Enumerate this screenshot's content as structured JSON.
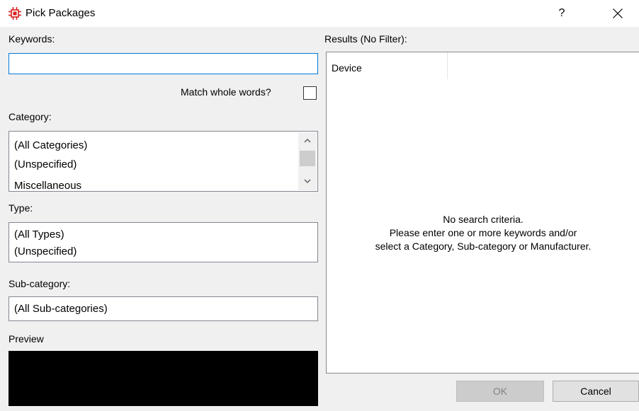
{
  "window": {
    "title": "Pick Packages",
    "help_label": "?",
    "app_icon": "chip-icon",
    "close_icon": "close-icon"
  },
  "keywords": {
    "label": "Keywords:",
    "value": "",
    "match_whole_words_label": "Match whole words?",
    "match_whole_words_checked": false
  },
  "category": {
    "label": "Category:",
    "items": [
      "(All Categories)",
      "(Unspecified)",
      "Miscellaneous"
    ]
  },
  "type": {
    "label": "Type:",
    "items": [
      "(All Types)",
      "(Unspecified)"
    ]
  },
  "subcategory": {
    "label": "Sub-category:",
    "items": [
      "(All Sub-categories)"
    ]
  },
  "preview": {
    "label": "Preview"
  },
  "results": {
    "label": "Results (No Filter):",
    "columns": [
      "Device"
    ],
    "empty_message": [
      "No search criteria.",
      "Please enter one or more keywords and/or",
      "select a Category, Sub-category or Manufacturer."
    ]
  },
  "buttons": {
    "ok": "OK",
    "cancel": "Cancel"
  },
  "colors": {
    "focus_border": "#0078d7",
    "icon_red": "#d9201e"
  }
}
